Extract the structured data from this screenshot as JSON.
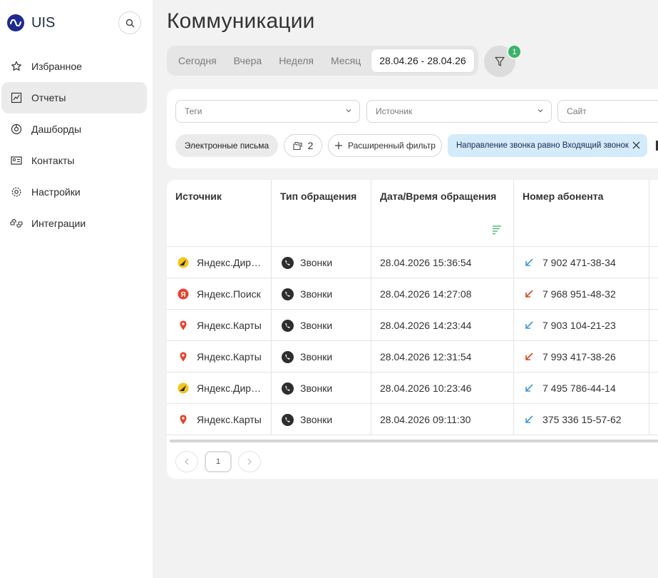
{
  "brand": {
    "name": "UIS"
  },
  "sidebar": {
    "items": [
      {
        "label": "Избранное",
        "icon": "star-icon",
        "active": false
      },
      {
        "label": "Отчеты",
        "icon": "chart-icon",
        "active": true
      },
      {
        "label": "Дашборды",
        "icon": "dashboard-icon",
        "active": false
      },
      {
        "label": "Контакты",
        "icon": "contact-card-icon",
        "active": false
      },
      {
        "label": "Настройки",
        "icon": "gear-icon",
        "active": false
      },
      {
        "label": "Интеграции",
        "icon": "integration-icon",
        "active": false
      }
    ]
  },
  "page": {
    "title": "Коммуникации"
  },
  "date_tabs": {
    "items": [
      "Сегодня",
      "Вчера",
      "Неделя",
      "Месяц"
    ],
    "selected_range": "28.04.26 - 28.04.26"
  },
  "filter_button": {
    "badge": "1"
  },
  "filters": {
    "tags_placeholder": "Теги",
    "source_placeholder": "Источник",
    "site_placeholder": "Сайт",
    "email_chip": "Электронные письма",
    "count_chip": "2",
    "extended_filter": "Расширенный фильтр",
    "active_filter": "Направление звонка равно Входящий звонок"
  },
  "table": {
    "columns": [
      "Источник",
      "Тип обращения",
      "Дата/Время обращения",
      "Номер абонента"
    ],
    "rows": [
      {
        "source": "Яндекс.Директ",
        "source_icon": "yandex-direct-icon",
        "type": "Звонки",
        "datetime": "28.04.2026 15:36:54",
        "number": "7 902 471-38-34",
        "direction_color": "#3d9ad9"
      },
      {
        "source": "Яндекс.Поиск",
        "source_icon": "yandex-search-icon",
        "type": "Звонки",
        "datetime": "28.04.2026 14:27:08",
        "number": "7 968 951-48-32",
        "direction_color": "#d9481c"
      },
      {
        "source": "Яндекс.Карты",
        "source_icon": "yandex-maps-icon",
        "type": "Звонки",
        "datetime": "28.04.2026 14:23:44",
        "number": "7 903 104-21-23",
        "direction_color": "#3d9ad9"
      },
      {
        "source": "Яндекс.Карты",
        "source_icon": "yandex-maps-icon",
        "type": "Звонки",
        "datetime": "28.04.2026 12:31:54",
        "number": "7 993 417-38-26",
        "direction_color": "#d9481c"
      },
      {
        "source": "Яндекс.Директ",
        "source_icon": "yandex-direct-icon",
        "type": "Звонки",
        "datetime": "28.04.2026 10:23:46",
        "number": "7 495 786-44-14",
        "direction_color": "#3d9ad9"
      },
      {
        "source": "Яндекс.Карты",
        "source_icon": "yandex-maps-icon",
        "type": "Звонки",
        "datetime": "28.04.2026 09:11:30",
        "number": "375 336 15-57-62",
        "direction_color": "#3d9ad9"
      }
    ]
  },
  "pagination": {
    "current_page": "1"
  },
  "colors": {
    "accent_green": "#3bb36b",
    "active_filter_bg": "#d3ebfa",
    "brand": "#1d2a8f"
  }
}
